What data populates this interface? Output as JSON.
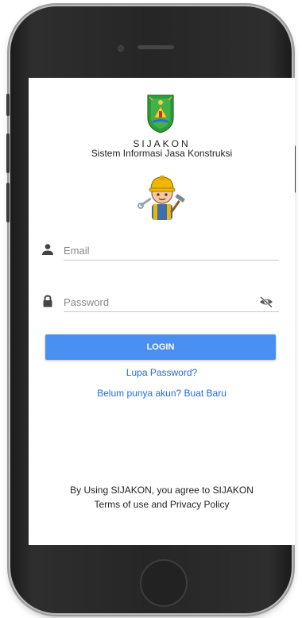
{
  "app": {
    "name": "SIJAKON",
    "subtitle": "Sistem Informasi Jasa Konstruksi"
  },
  "form": {
    "email_placeholder": "Email",
    "password_placeholder": "Password",
    "email_value": "",
    "password_value": "",
    "login_label": "LOGIN"
  },
  "links": {
    "forgot_password": "Lupa Password?",
    "register": "Belum punya akun? Buat Baru"
  },
  "footer": {
    "line1": "By Using SIJAKON, you agree to SIJAKON",
    "line2": "Terms of use and Privacy Policy"
  },
  "icons": {
    "email": "person-icon",
    "password": "lock-icon",
    "visibility": "eye-off-icon",
    "logo": "regional-emblem-logo",
    "mascot": "construction-worker-mascot"
  },
  "colors": {
    "primary_button": "#4a90f2",
    "link": "#1e6ce0",
    "phone_frame": "#262626"
  }
}
